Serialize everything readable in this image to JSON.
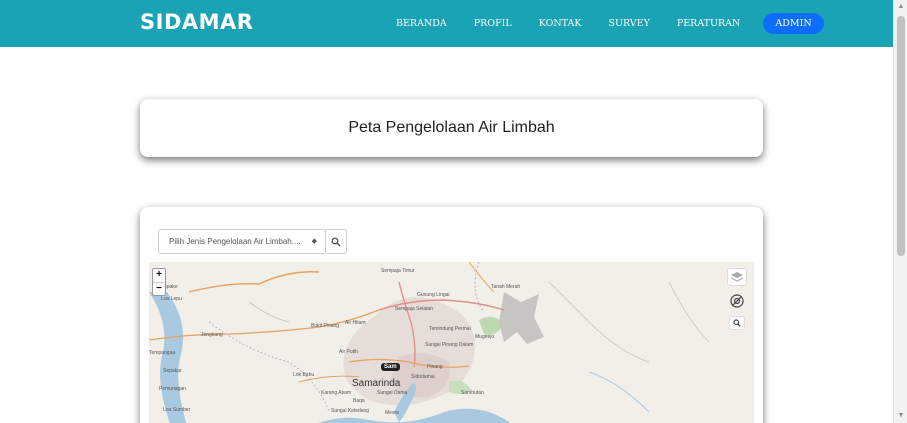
{
  "navbar": {
    "brand": "SIDAMAR",
    "links": [
      "BERANDA",
      "PROFIL",
      "KONTAK",
      "SURVEY",
      "PERATURAN"
    ],
    "admin_label": "ADMIN",
    "bg_color": "#1aa3b5",
    "admin_color": "#0d6efd"
  },
  "title_card": {
    "title": "Peta Pengelolaan Air Limbah"
  },
  "map_card": {
    "select_value": "Pilih Jenis Pengelolaan Air Limbah....",
    "search_icon": "search-icon",
    "map": {
      "zoom_in": "+",
      "zoom_out": "−",
      "labels": {
        "sempaja_timur": "Sempaja Timur",
        "tanah_merah": "Tanah Merah",
        "gunung_lingai": "Gunung Lingai",
        "sempaja_selatan": "Sempaja Selatan",
        "lempake": "Lempake",
        "loa_lepu": "Loa Lepu",
        "jongkang": "Jongkang",
        "bukit_pinang": "Bukit Pinang",
        "air_hitam": "Air Hitam",
        "temindung_permai": "Temindung Permai",
        "mugirejo": "Mugirejo",
        "sungai_pinang_dalam": "Sungai Pinang Dalam",
        "air_putih": "Air Putih",
        "tempangaa": "Tempangaa",
        "sepakar": "Sepakar",
        "lok_bahu": "Lok Bahu",
        "pinang": "Pinang",
        "sidodamai": "Sidodamai",
        "samarinda": "Samarinda",
        "sambutan": "Sambutan",
        "pemunagan": "Pemunagan",
        "karang_asam": "Karang Asam",
        "sungai_dama": "Sungai Dama",
        "loa_sumber": "Loa Sumber",
        "baqa": "Baqa",
        "sungai_keledang": "Sungai Keledang",
        "mesra": "Mesra",
        "marker": "Sam"
      }
    }
  }
}
